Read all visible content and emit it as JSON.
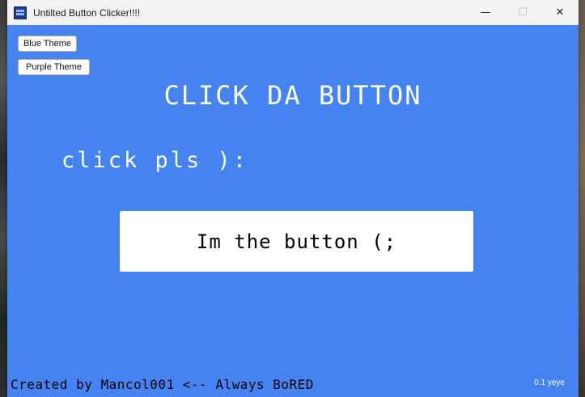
{
  "window": {
    "title": "Untilted Button Clicker!!!!",
    "icon": "app-icon",
    "background_color": "#4483f0",
    "controls": {
      "minimize_glyph": "—",
      "maximize_glyph": "☐",
      "close_glyph": "✕"
    }
  },
  "themes": {
    "blue_label": "Blue Theme",
    "purple_label": "Purple Theme"
  },
  "content": {
    "headline": "CLICK DA BUTTON",
    "prompt": "click pls ):",
    "main_button_label": "Im the button (;"
  },
  "footer": {
    "credit": "Created by Mancol001 <-- Always BoRED",
    "version": "0.1 yeye"
  }
}
